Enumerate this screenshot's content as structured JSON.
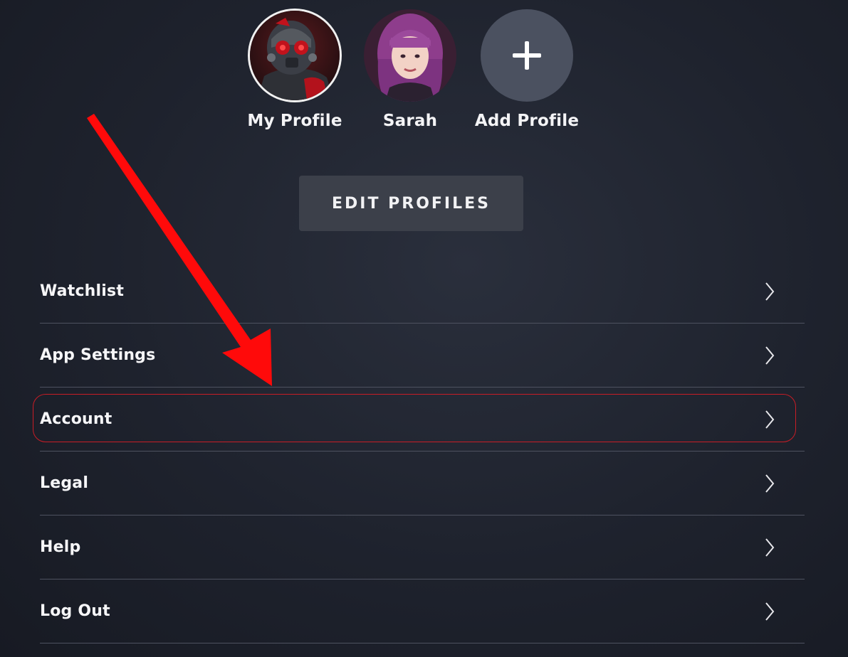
{
  "profiles": [
    {
      "name": "My Profile",
      "selected": true,
      "avatar": "ant-man-helmet-avatar"
    },
    {
      "name": "Sarah",
      "selected": false,
      "avatar": "purple-hair-avatar"
    },
    {
      "name": "Add Profile",
      "selected": false,
      "avatar": "plus-icon"
    }
  ],
  "edit_profiles_label": "EDIT PROFILES",
  "menu": {
    "items": [
      {
        "label": "Watchlist"
      },
      {
        "label": "App Settings"
      },
      {
        "label": "Account",
        "highlighted": true
      },
      {
        "label": "Legal"
      },
      {
        "label": "Help"
      },
      {
        "label": "Log Out"
      }
    ]
  },
  "annotation": {
    "arrow_color": "#ff0a0a",
    "ring_color": "#c91d26",
    "points_to": "Account"
  },
  "colors": {
    "background": "#1e222d",
    "button": "#3c404a",
    "add_profile_circle": "#4b5160",
    "divider": "#4e5260"
  }
}
